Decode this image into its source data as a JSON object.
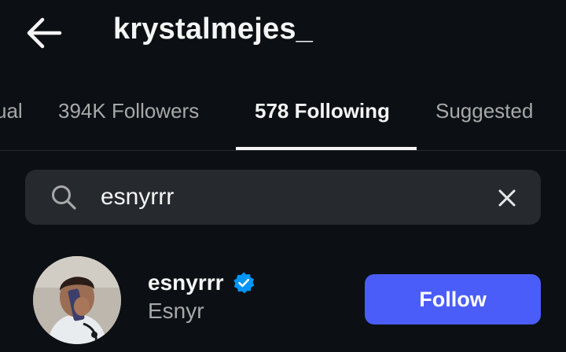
{
  "header": {
    "back_icon": "arrow-left-icon",
    "title": "krystalmejes_"
  },
  "tabs": [
    {
      "label": "ual",
      "active": false
    },
    {
      "label": "394K Followers",
      "active": false
    },
    {
      "label": "578 Following",
      "active": true
    },
    {
      "label": "Suggested",
      "active": false
    }
  ],
  "search": {
    "icon": "search-icon",
    "value": "esnyrrr",
    "placeholder": "Search",
    "clear_icon": "close-icon"
  },
  "results": [
    {
      "username": "esnyrrr",
      "verified": true,
      "full_name": "Esnyr",
      "action_label": "Follow"
    }
  ],
  "colors": {
    "background": "#0c1014",
    "search_background": "#262a2f",
    "text_primary": "#f5f5f5",
    "text_secondary": "#a8a8a8",
    "follow_button": "#4a5df9",
    "verified_badge": "#0095f6"
  }
}
